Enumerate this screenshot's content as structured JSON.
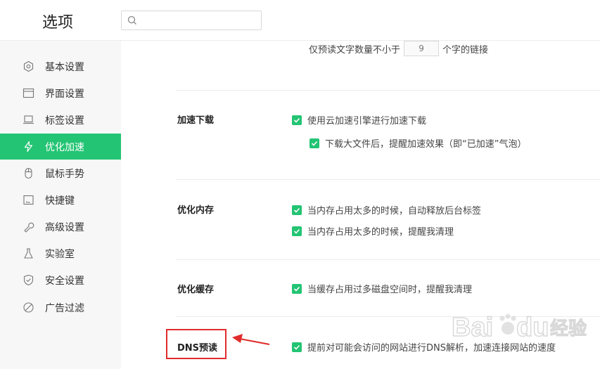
{
  "header": {
    "title": "选项",
    "search_placeholder": ""
  },
  "sidebar": {
    "items": [
      {
        "label": "基本设置",
        "icon": "hexagon-gear-icon"
      },
      {
        "label": "界面设置",
        "icon": "window-icon"
      },
      {
        "label": "标签设置",
        "icon": "laptop-icon"
      },
      {
        "label": "优化加速",
        "icon": "lightning-icon",
        "active": true
      },
      {
        "label": "鼠标手势",
        "icon": "mouse-icon"
      },
      {
        "label": "快捷键",
        "icon": "keyboard-icon"
      },
      {
        "label": "高级设置",
        "icon": "wrench-icon"
      },
      {
        "label": "实验室",
        "icon": "flask-icon"
      },
      {
        "label": "安全设置",
        "icon": "shield-icon"
      },
      {
        "label": "广告过滤",
        "icon": "block-icon"
      }
    ]
  },
  "content": {
    "preread": {
      "prefix": "仅预读文字数量不小于",
      "value": "9",
      "suffix": "个字的链接"
    },
    "download": {
      "title": "加速下载",
      "opt1": "使用云加速引擎进行加速下载",
      "opt2": "下载大文件后，提醒加速效果（即“已加速”气泡）"
    },
    "memory": {
      "title": "优化内存",
      "opt1": "当内存占用太多的时候，自动释放后台标签",
      "opt2": "当内存占用太多的时候，提醒我清理"
    },
    "cache": {
      "title": "优化缓存",
      "opt1": "当缓存占用过多磁盘空间时，提醒我清理"
    },
    "dns": {
      "title": "DNS预读",
      "opt1": "提前对可能会访问的网站进行DNS解析，加速连接网站的速度"
    }
  },
  "watermark": {
    "text1": "Bai",
    "text2": "du",
    "text3": "经验"
  },
  "colors": {
    "accent": "#23c473",
    "highlight": "#e02c2c",
    "sidebar_bg": "#f7f7f7"
  }
}
